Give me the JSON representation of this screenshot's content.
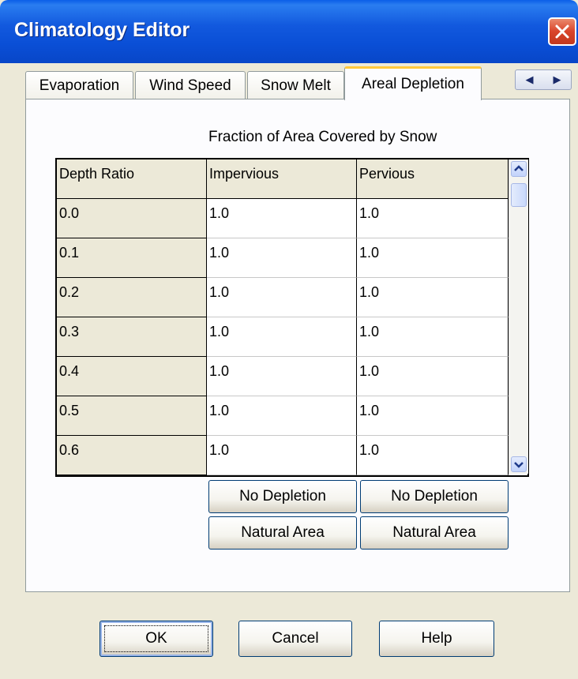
{
  "window": {
    "title": "Climatology Editor"
  },
  "tabs": [
    {
      "label": "Evaporation"
    },
    {
      "label": "Wind Speed"
    },
    {
      "label": "Snow Melt"
    },
    {
      "label": "Areal Depletion"
    }
  ],
  "active_tab": "Areal Depletion",
  "caption": "Fraction of Area Covered by Snow",
  "grid": {
    "headers": [
      "Depth Ratio",
      "Impervious",
      "Pervious"
    ],
    "rows": [
      {
        "depth": "0.0",
        "impervious": "1.0",
        "pervious": "1.0"
      },
      {
        "depth": "0.1",
        "impervious": "1.0",
        "pervious": "1.0"
      },
      {
        "depth": "0.2",
        "impervious": "1.0",
        "pervious": "1.0"
      },
      {
        "depth": "0.3",
        "impervious": "1.0",
        "pervious": "1.0"
      },
      {
        "depth": "0.4",
        "impervious": "1.0",
        "pervious": "1.0"
      },
      {
        "depth": "0.5",
        "impervious": "1.0",
        "pervious": "1.0"
      },
      {
        "depth": "0.6",
        "impervious": "1.0",
        "pervious": "1.0"
      }
    ]
  },
  "impervious_buttons": {
    "no_depletion": "No Depletion",
    "natural_area": "Natural Area"
  },
  "pervious_buttons": {
    "no_depletion": "No Depletion",
    "natural_area": "Natural Area"
  },
  "footer": {
    "ok": "OK",
    "cancel": "Cancel",
    "help": "Help"
  },
  "colors": {
    "titlebar": "#0a4fd6",
    "dialog_bg": "#ece9d8",
    "active_tab_accent": "#ffc83c",
    "close_button": "#d9442a"
  },
  "icons": {
    "close": "close-icon",
    "tab_left": "chevron-left-icon",
    "tab_right": "chevron-right-icon",
    "scroll_up": "chevron-up-icon",
    "scroll_down": "chevron-down-icon"
  }
}
